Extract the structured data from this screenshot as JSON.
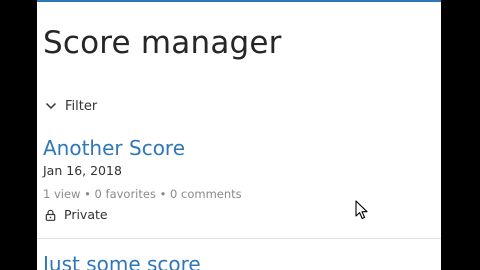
{
  "header": {
    "title": "Score manager",
    "accent_color": "#2e78b8"
  },
  "filter": {
    "label": "Filter",
    "icon": "chevron-down-icon"
  },
  "scores": [
    {
      "title": "Another Score",
      "date": "Jan 16, 2018",
      "stats": "1 view • 0 favorites • 0 comments",
      "privacy": "Private",
      "privacy_icon": "lock-icon"
    },
    {
      "title": "Just some score"
    }
  ],
  "colors": {
    "link": "#2e78b8",
    "text": "#333333",
    "muted": "#8a8a8a",
    "background": "#ffffff",
    "outer_background": "#000000"
  }
}
